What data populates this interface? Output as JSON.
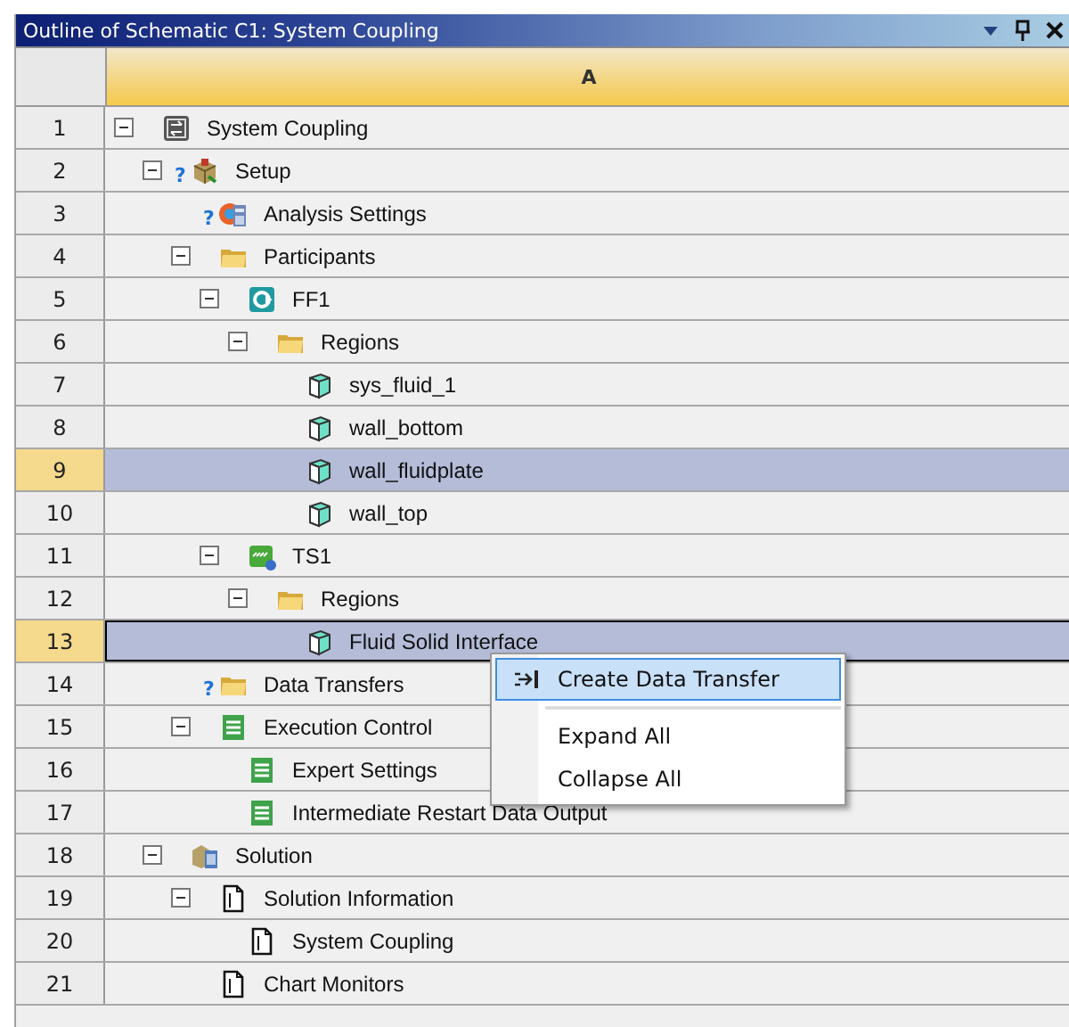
{
  "panel": {
    "title": "Outline of Schematic C1: System Coupling"
  },
  "table": {
    "columns": [
      "A"
    ],
    "tree": [
      {
        "row": "1",
        "label": "System Coupling",
        "kind": "coupling",
        "expanded": true,
        "selected": false,
        "focused": false,
        "children": [
          {
            "row": "2",
            "label": "Setup",
            "kind": "setup",
            "badge": "?",
            "expanded": true,
            "selected": false,
            "focused": false,
            "children": [
              {
                "row": "3",
                "label": "Analysis Settings",
                "kind": "settings",
                "badge": "?",
                "selected": false,
                "focused": false
              },
              {
                "row": "4",
                "label": "Participants",
                "kind": "folder",
                "expanded": true,
                "selected": false,
                "focused": false,
                "children": [
                  {
                    "row": "5",
                    "label": "FF1",
                    "kind": "fluid",
                    "expanded": true,
                    "selected": false,
                    "focused": false,
                    "children": [
                      {
                        "row": "6",
                        "label": "Regions",
                        "kind": "folder",
                        "expanded": true,
                        "selected": false,
                        "focused": false,
                        "children": [
                          {
                            "row": "7",
                            "label": "sys_fluid_1",
                            "kind": "cube",
                            "selected": false,
                            "focused": false
                          },
                          {
                            "row": "8",
                            "label": "wall_bottom",
                            "kind": "cube",
                            "selected": false,
                            "focused": false
                          },
                          {
                            "row": "9",
                            "label": "wall_fluidplate",
                            "kind": "cube",
                            "selected": true,
                            "focused": false
                          },
                          {
                            "row": "10",
                            "label": "wall_top",
                            "kind": "cube",
                            "selected": false,
                            "focused": false
                          }
                        ]
                      }
                    ]
                  },
                  {
                    "row": "11",
                    "label": "TS1",
                    "kind": "thermal",
                    "expanded": true,
                    "selected": false,
                    "focused": false,
                    "children": [
                      {
                        "row": "12",
                        "label": "Regions",
                        "kind": "folder",
                        "expanded": true,
                        "selected": false,
                        "focused": false,
                        "children": [
                          {
                            "row": "13",
                            "label": "Fluid Solid Interface",
                            "kind": "cube",
                            "selected": true,
                            "focused": true
                          }
                        ]
                      }
                    ]
                  }
                ]
              },
              {
                "row": "14",
                "label": "Data Transfers",
                "kind": "folder",
                "badge": "?",
                "selected": false,
                "focused": false
              },
              {
                "row": "15",
                "label": "Execution Control",
                "kind": "list",
                "expanded": true,
                "selected": false,
                "focused": false,
                "children": [
                  {
                    "row": "16",
                    "label": "Expert Settings",
                    "kind": "list",
                    "selected": false,
                    "focused": false
                  },
                  {
                    "row": "17",
                    "label": "Intermediate Restart Data Output",
                    "kind": "list",
                    "selected": false,
                    "focused": false
                  }
                ]
              }
            ]
          },
          {
            "row": "18",
            "label": "Solution",
            "kind": "solution",
            "expanded": true,
            "selected": false,
            "focused": false,
            "children": [
              {
                "row": "19",
                "label": "Solution Information",
                "kind": "document",
                "expanded": true,
                "selected": false,
                "focused": false,
                "children": [
                  {
                    "row": "20",
                    "label": "System Coupling",
                    "kind": "document",
                    "selected": false,
                    "focused": false
                  }
                ]
              },
              {
                "row": "21",
                "label": "Chart Monitors",
                "kind": "document",
                "selected": false,
                "focused": false
              }
            ]
          }
        ]
      }
    ]
  },
  "context_menu": {
    "items": [
      {
        "kind": "command",
        "label": "Create Data Transfer",
        "selected": true
      },
      {
        "kind": "separator"
      },
      {
        "kind": "command",
        "label": "Expand All",
        "selected": false
      },
      {
        "kind": "command",
        "label": "Collapse All",
        "selected": false
      }
    ]
  }
}
